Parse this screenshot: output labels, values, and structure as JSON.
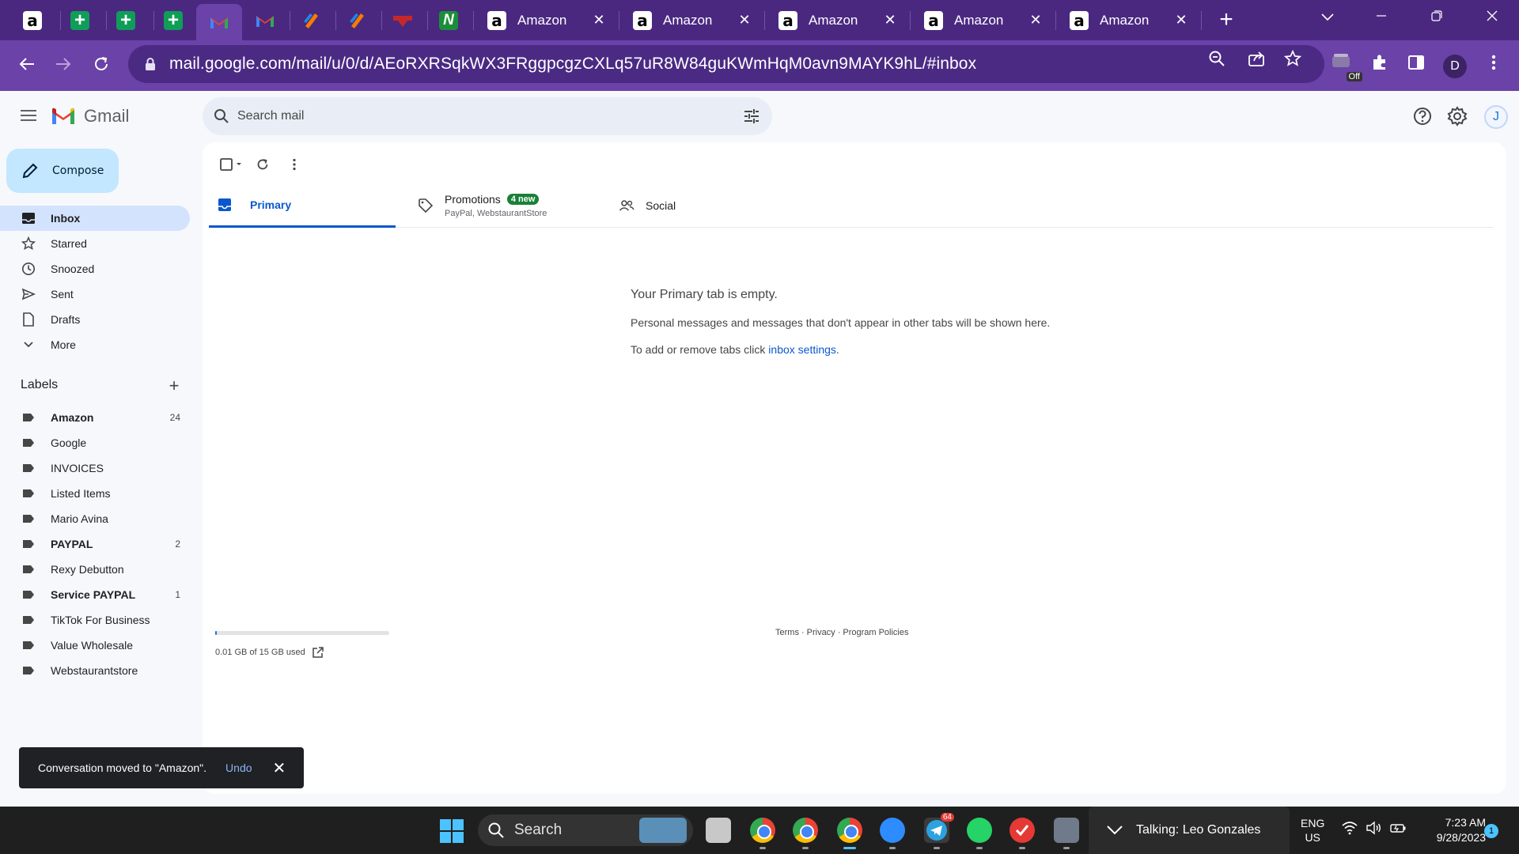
{
  "browser": {
    "tabs": [
      {
        "icon": "amazon-icon",
        "glyph": "a"
      },
      {
        "icon": "sheets-icon",
        "glyph": "+"
      },
      {
        "icon": "sheets-icon",
        "glyph": "+"
      },
      {
        "icon": "sheets-icon",
        "glyph": "+"
      },
      {
        "icon": "gmail-icon",
        "glyph": "M",
        "active": true
      },
      {
        "icon": "gmail-icon",
        "glyph": "M"
      },
      {
        "icon": "orange-app-icon",
        "glyph": ""
      },
      {
        "icon": "orange-app-icon",
        "glyph": ""
      },
      {
        "icon": "red-logo-icon",
        "glyph": ""
      },
      {
        "icon": "green-app-icon",
        "glyph": "N"
      }
    ],
    "amazon_tabs": [
      {
        "title": "Amazon",
        "glyph": "a",
        "close": "✕"
      },
      {
        "title": "Amazon",
        "glyph": "a",
        "close": "✕"
      },
      {
        "title": "Amazon",
        "glyph": "a",
        "close": "✕"
      },
      {
        "title": "Amazon",
        "glyph": "a",
        "close": "✕"
      },
      {
        "title": "Amazon",
        "glyph": "a",
        "close": "✕"
      }
    ],
    "new_tab": "+",
    "url": "mail.google.com/mail/u/0/d/AEoRXRSqkWX3FRggpcgzCXLq57uR8W84guKWmHqM0avn9MAYK9hL/#inbox",
    "extension_badge": "Off",
    "profile_initial": "D",
    "theme_color": "#6a42a8"
  },
  "gmail": {
    "app_name": "Gmail",
    "search_placeholder": "Search mail",
    "account_initial": "J",
    "compose_label": "Compose",
    "nav": [
      {
        "label": "Inbox",
        "icon": "inbox-icon",
        "active": true
      },
      {
        "label": "Starred",
        "icon": "star-icon"
      },
      {
        "label": "Snoozed",
        "icon": "clock-icon"
      },
      {
        "label": "Sent",
        "icon": "send-icon"
      },
      {
        "label": "Drafts",
        "icon": "draft-icon"
      },
      {
        "label": "More",
        "icon": "chevron-down-icon"
      }
    ],
    "labels_title": "Labels",
    "labels": [
      {
        "name": "Amazon",
        "count": "24",
        "bold": true
      },
      {
        "name": "Google",
        "count": ""
      },
      {
        "name": "INVOICES",
        "count": ""
      },
      {
        "name": "Listed Items",
        "count": ""
      },
      {
        "name": "Mario Avina",
        "count": ""
      },
      {
        "name": "PAYPAL",
        "count": "2",
        "bold": true
      },
      {
        "name": "Rexy Debutton",
        "count": ""
      },
      {
        "name": "Service PAYPAL",
        "count": "1",
        "bold": true
      },
      {
        "name": "TikTok For Business",
        "count": ""
      },
      {
        "name": "Value Wholesale",
        "count": ""
      },
      {
        "name": "Webstaurantstore",
        "count": ""
      }
    ],
    "category_tabs": {
      "primary": "Primary",
      "promotions": "Promotions",
      "promotions_badge": "4 new",
      "promotions_senders": "PayPal, WebstaurantStore",
      "social": "Social"
    },
    "empty_state": {
      "title": "Your Primary tab is empty.",
      "body": "Personal messages and messages that don't appear in other tabs will be shown here.",
      "settings_prefix": "To add or remove tabs click ",
      "settings_link": "inbox settings",
      "settings_suffix": "."
    },
    "storage": {
      "text": "0.01 GB of 15 GB used",
      "fraction": 0.001
    },
    "footer": {
      "terms": "Terms",
      "privacy": "Privacy",
      "policies": "Program Policies",
      "separator": "·"
    },
    "snackbar": {
      "message": "Conversation moved to \"Amazon\".",
      "undo": "Undo",
      "close": "✕"
    }
  },
  "taskbar": {
    "search_label": "Search",
    "talking": "Talking: Leo Gonzales",
    "lang_top": "ENG",
    "lang_bottom": "US",
    "time": "7:23 AM",
    "date": "9/28/2023",
    "notifications": "1",
    "telegram_badge": "64"
  },
  "accent": "#0b57d0"
}
